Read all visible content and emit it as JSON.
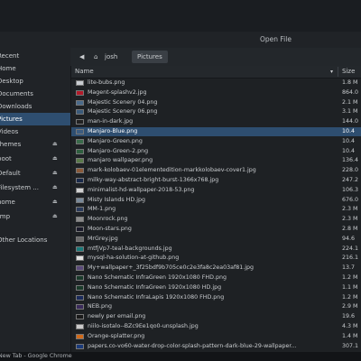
{
  "window": {
    "title": "Open File"
  },
  "pathbar": {
    "back_glyph": "◀",
    "home_glyph": "⌂",
    "crumbs": [
      "josh",
      "Pictures"
    ]
  },
  "sidebar": {
    "items": [
      {
        "label": "Recent"
      },
      {
        "label": "Home"
      },
      {
        "label": "Desktop"
      },
      {
        "label": "Documents"
      },
      {
        "label": "Downloads"
      },
      {
        "label": "Pictures"
      },
      {
        "label": "Videos"
      },
      {
        "label": "themes",
        "eject": "⏏"
      },
      {
        "label": "boot",
        "eject": "⏏"
      },
      {
        "label": "Default",
        "eject": "⏏"
      },
      {
        "label": "Filesystem ...",
        "eject": "⏏"
      },
      {
        "label": "home",
        "eject": "⏏"
      },
      {
        "label": "tmp",
        "eject": "⏏"
      },
      {
        "label": "Other Locations"
      }
    ]
  },
  "list": {
    "headers": {
      "name": "Name",
      "size": "Size",
      "sort_glyph": "▾"
    },
    "rows": [
      {
        "name": "lite-bubs.png",
        "size": "1.8 M",
        "thumb": "#c8ccd0"
      },
      {
        "name": "Magent-splashv2.jpg",
        "size": "864.0",
        "thumb": "#b21a2a"
      },
      {
        "name": "Majestic Scenery 04.png",
        "size": "2.1 M",
        "thumb": "#4a6a8a"
      },
      {
        "name": "Majestic Scenery 06.png",
        "size": "3.1 M",
        "thumb": "#3a5a7a"
      },
      {
        "name": "man-in-dark.jpg",
        "size": "144.0",
        "thumb": "#222222"
      },
      {
        "name": "Manjaro-Blue.png",
        "size": "10.4",
        "thumb": "#3c5c80"
      },
      {
        "name": "Manjaro-Green.png",
        "size": "10.4",
        "thumb": "#3a6a4a"
      },
      {
        "name": "Manjaro-Green-2.png",
        "size": "10.4",
        "thumb": "#2f5f3f"
      },
      {
        "name": "manjaro wallpaper.png",
        "size": "136.4",
        "thumb": "#5a7a4a"
      },
      {
        "name": "mark-kolobaev-01elementedition-markkolobaev-cover1.jpg",
        "size": "228.0",
        "thumb": "#8a5a3a"
      },
      {
        "name": "milky-way-abstract-bright-burst-1366x768.jpg",
        "size": "247.2",
        "thumb": "#1a2a4a"
      },
      {
        "name": "minimalist-hd-wallpaper-2018-53.png",
        "size": "106.3",
        "thumb": "#d0d0d0"
      },
      {
        "name": "Misty Islands HD.jpg",
        "size": "676.0",
        "thumb": "#7a8a9a"
      },
      {
        "name": "MM-1.png",
        "size": "2.3 M",
        "thumb": "#2a3a5a"
      },
      {
        "name": "Moonrock.png",
        "size": "2.3 M",
        "thumb": "#8a8a8a"
      },
      {
        "name": "Moon-stars.png",
        "size": "2.8 M",
        "thumb": "#1a1a2a"
      },
      {
        "name": "MrGrey.jpg",
        "size": "94.6",
        "thumb": "#6a6a6a"
      },
      {
        "name": "mtfjVp7-teal-backgrounds.jpg",
        "size": "224.1",
        "thumb": "#1a7a7a"
      },
      {
        "name": "mysql-ha-solution-at-github.png",
        "size": "216.1",
        "thumb": "#e0e0e0"
      },
      {
        "name": "My+wallpaper+_3f25bdf9b705ce0c2e3fa8c2ea03af81.jpg",
        "size": "13.7",
        "thumb": "#5a4a7a"
      },
      {
        "name": "Nano Schematic InfraGreen 1920x1080 FHD.png",
        "size": "1.2 M",
        "thumb": "#1a3a2a"
      },
      {
        "name": "Nano Schematic InfraGreen 1920x1080 HD.jpg",
        "size": "1.1 M",
        "thumb": "#1a3a2a"
      },
      {
        "name": "Nano Schematic InfraLapis 1920x1080 FHD.png",
        "size": "1.2 M",
        "thumb": "#1a2a5a"
      },
      {
        "name": "NEB.png",
        "size": "2.9 M",
        "thumb": "#3a2a5a"
      },
      {
        "name": "newly per email.png",
        "size": "19.6",
        "thumb": "#1a1a1a"
      },
      {
        "name": "niilo-isotalo--BZc9Ee1qo0-unsplash.jpg",
        "size": "4.3 M",
        "thumb": "#cacaca"
      },
      {
        "name": "Orange-splatter.png",
        "size": "1.4 M",
        "thumb": "#d06a1a"
      },
      {
        "name": "papers.co-vo60-water-drop-color-splash-pattern-dark-blue-29-wallpaper...",
        "size": "307.1",
        "thumb": "#1a3a7a"
      }
    ]
  },
  "taskbar": {
    "label": "New Tab - Google Chrome"
  }
}
